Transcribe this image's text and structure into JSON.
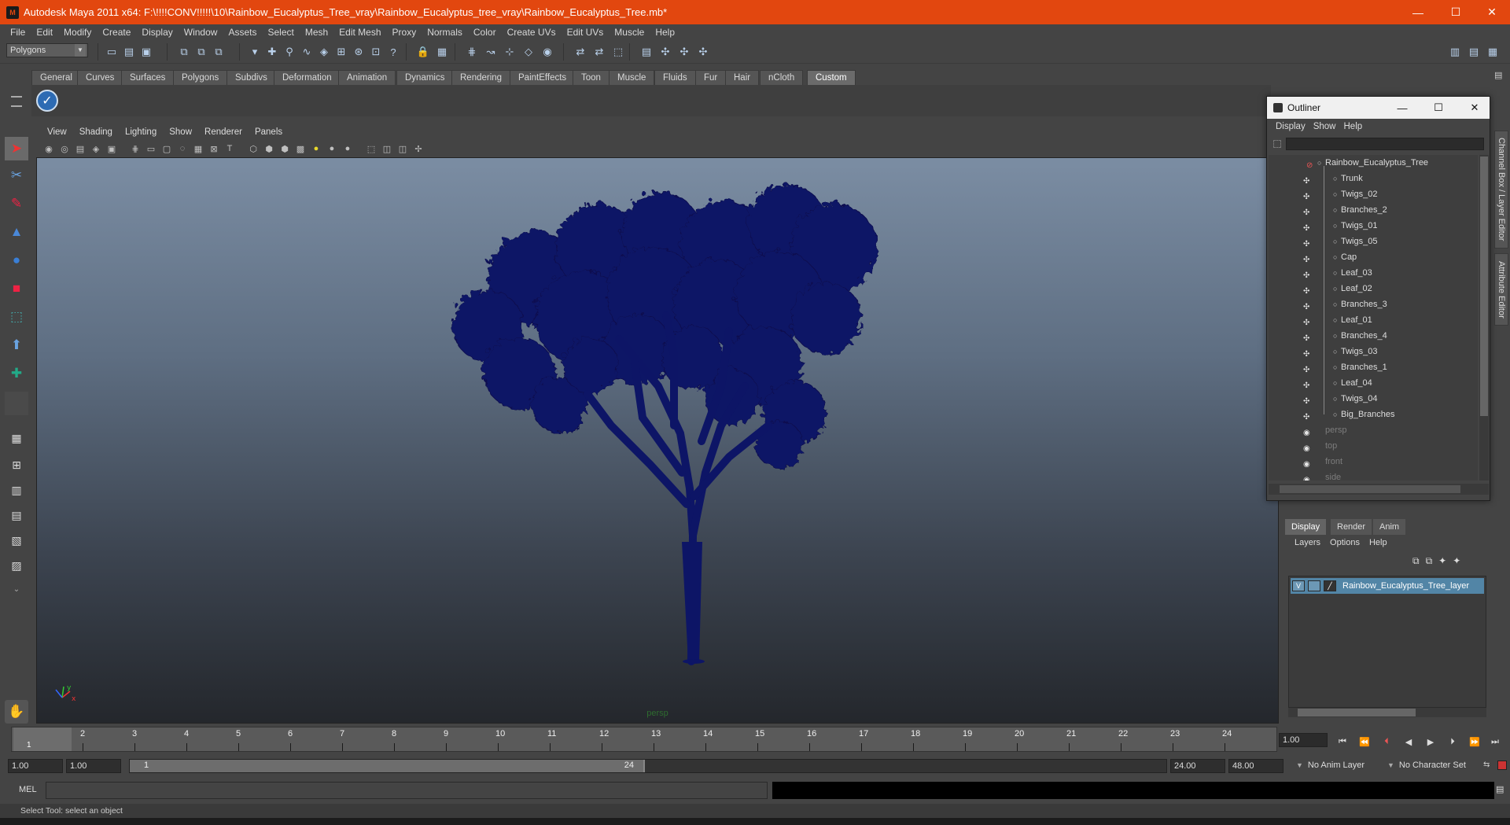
{
  "window": {
    "title": "Autodesk Maya 2011 x64: F:\\!!!!CONV!!!!!\\10\\Rainbow_Eucalyptus_Tree_vray\\Rainbow_Eucalyptus_tree_vray\\Rainbow_Eucalyptus_Tree.mb*",
    "minimize": "—",
    "maximize": "☐",
    "close": "✕"
  },
  "menubar": [
    "File",
    "Edit",
    "Modify",
    "Create",
    "Display",
    "Window",
    "Assets",
    "Select",
    "Mesh",
    "Edit Mesh",
    "Proxy",
    "Normals",
    "Color",
    "Create UVs",
    "Edit UVs",
    "Muscle",
    "Help"
  ],
  "statusline": {
    "mode": "Polygons"
  },
  "shelf": {
    "tabs": [
      "General",
      "Curves",
      "Surfaces",
      "Polygons",
      "Subdivs",
      "Deformation",
      "Animation",
      "Dynamics",
      "Rendering",
      "PaintEffects",
      "Toon",
      "Muscle",
      "Fluids",
      "Fur",
      "Hair",
      "nCloth",
      "Custom"
    ],
    "active": "Custom"
  },
  "viewport": {
    "menu": [
      "View",
      "Shading",
      "Lighting",
      "Show",
      "Renderer",
      "Panels"
    ],
    "camera_label": "persp"
  },
  "timeline": {
    "ticks": [
      "1",
      "2",
      "3",
      "4",
      "5",
      "6",
      "7",
      "8",
      "9",
      "10",
      "11",
      "12",
      "13",
      "14",
      "15",
      "16",
      "17",
      "18",
      "19",
      "20",
      "21",
      "22",
      "23",
      "24"
    ],
    "current_frame": "1",
    "current_time_field": "1.00"
  },
  "range": {
    "start": "1.00",
    "playback_start": "1.00",
    "slider_start": "1",
    "slider_end": "24",
    "playback_end": "24.00",
    "end": "48.00",
    "anim_layer": "No Anim Layer",
    "character_set": "No Character Set"
  },
  "cmdline": {
    "label": "MEL"
  },
  "helpline": {
    "text": "Select Tool: select an object"
  },
  "sidetabs": {
    "channel_box": "Channel Box / Layer Editor",
    "attribute_editor": "Attribute Editor"
  },
  "outliner": {
    "title": "Outliner",
    "menu": [
      "Display",
      "Show",
      "Help"
    ],
    "root": "Rainbow_Eucalyptus_Tree",
    "children": [
      "Trunk",
      "Twigs_02",
      "Branches_2",
      "Twigs_01",
      "Twigs_05",
      "Cap",
      "Leaf_03",
      "Leaf_02",
      "Branches_3",
      "Leaf_01",
      "Branches_4",
      "Twigs_03",
      "Branches_1",
      "Leaf_04",
      "Twigs_04",
      "Big_Branches"
    ],
    "cameras": [
      "persp",
      "top",
      "front",
      "side"
    ]
  },
  "layer_editor": {
    "tabs": [
      "Display",
      "Render",
      "Anim"
    ],
    "active_tab": "Display",
    "menu": [
      "Layers",
      "Options",
      "Help"
    ],
    "layers": [
      {
        "visible": "V",
        "name": "Rainbow_Eucalyptus_Tree_layer"
      }
    ]
  },
  "colors": {
    "titlebar": "#e2470f",
    "tree": "#0d1566",
    "selection": "#5285a6"
  }
}
